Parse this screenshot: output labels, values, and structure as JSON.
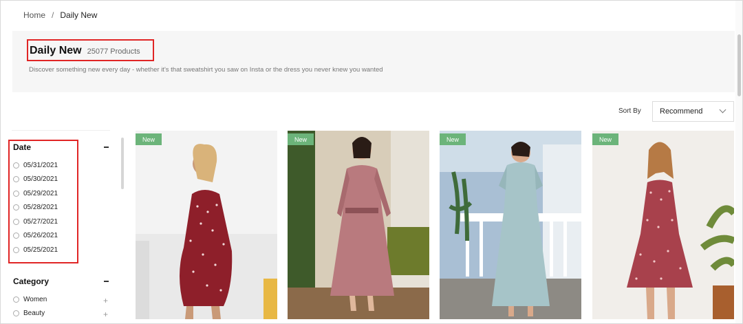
{
  "breadcrumb": {
    "home": "Home",
    "separator": "/",
    "current": "Daily New"
  },
  "banner": {
    "title": "Daily New",
    "count": "25077 Products",
    "description": "Discover something new every day - whether it's that sweatshirt you saw on Insta or the dress you never knew you wanted"
  },
  "sort": {
    "label": "Sort By",
    "selected": "Recommend"
  },
  "filters": {
    "date": {
      "title": "Date",
      "options": [
        "05/31/2021",
        "05/30/2021",
        "05/29/2021",
        "05/28/2021",
        "05/27/2021",
        "05/26/2021",
        "05/25/2021"
      ]
    },
    "category": {
      "title": "Category",
      "options": [
        "Women",
        "Beauty"
      ]
    }
  },
  "products": [
    {
      "badge": "New",
      "image": "burgundy polka dot maternity dress",
      "bg": "#e9e9e9",
      "dress": "#8e1f2a"
    },
    {
      "badge": "New",
      "image": "pink metallic pleated long dress",
      "bg": "#c9b79c",
      "dress": "#b97a7e"
    },
    {
      "badge": "New",
      "image": "light blue lace tiered maxi dress",
      "bg": "#a9bfd4",
      "dress": "#a6c4c8"
    },
    {
      "badge": "New",
      "image": "red floral cami dress",
      "bg": "#eae7e3",
      "dress": "#a8414c"
    }
  ],
  "colors": {
    "highlight": "#e02424",
    "badge": "#6cb47a"
  }
}
